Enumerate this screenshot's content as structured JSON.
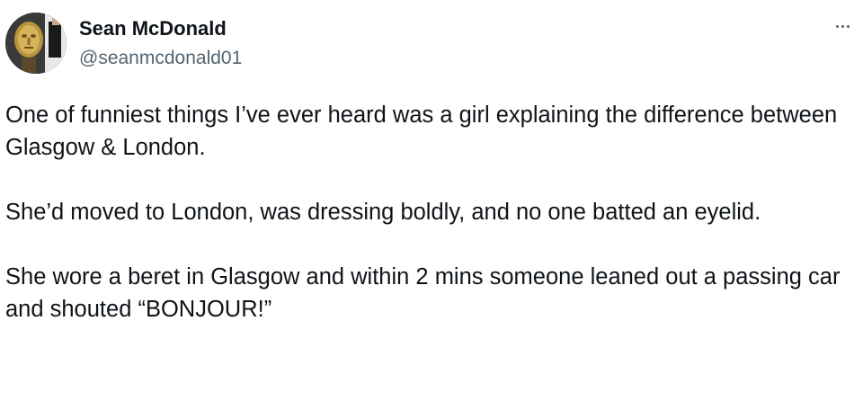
{
  "author": {
    "name": "Sean McDonald",
    "handle": "@seanmcdonald01",
    "avatar_icon": "bafta-mask-avatar-icon"
  },
  "menu": {
    "icon": "more-horizontal-icon"
  },
  "post": {
    "paragraphs": [
      "One of funniest things I’ve ever heard was a girl explaining the difference between Glasgow & London.",
      "She’d moved to London, was dressing boldly, and no one batted an eyelid.",
      "She wore a beret in Glasgow and within 2 mins someone leaned out a passing car and shouted “BONJOUR!”"
    ]
  },
  "colors": {
    "text_primary": "#0f1419",
    "text_secondary": "#536471",
    "background": "#ffffff"
  }
}
